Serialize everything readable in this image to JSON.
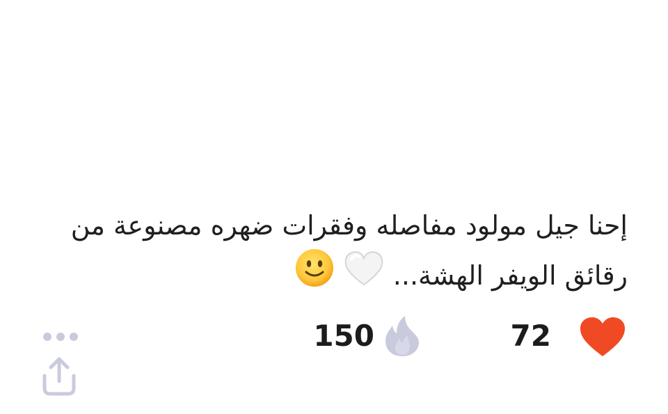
{
  "post": {
    "text_line_1": "إحنا جيل مولود مفاصله وفقرات ضهره مصنوعة من",
    "text_line_2": "رقائق الويفر الهشة...",
    "emojis": [
      "white-heart-icon",
      "slightly-smiling-face-icon"
    ]
  },
  "stats": {
    "likes": {
      "icon": "heart-icon",
      "count": "72",
      "color": "#F04A25"
    },
    "fire": {
      "icon": "fire-icon",
      "count": "150",
      "color": "#C9CBDD"
    }
  },
  "actions": {
    "more": {
      "icon": "more-dots-icon",
      "color": "#C9CBDD"
    },
    "share": {
      "icon": "share-icon",
      "color": "#C9CBDD"
    }
  }
}
